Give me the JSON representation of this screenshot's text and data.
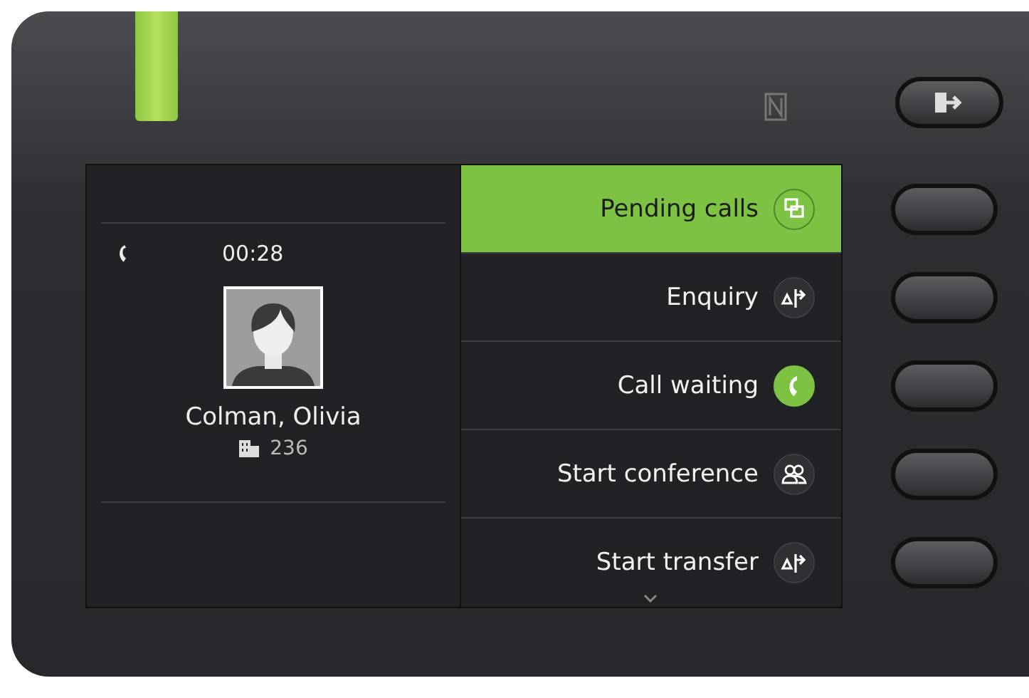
{
  "call": {
    "duration": "00:28",
    "name": "Colman, Olivia",
    "extension": "236"
  },
  "menu": [
    {
      "label": "Pending calls",
      "kind": "pending",
      "selected": true
    },
    {
      "label": "Enquiry",
      "kind": "enquiry",
      "selected": false
    },
    {
      "label": "Call waiting",
      "kind": "answer",
      "selected": false
    },
    {
      "label": "Start conference",
      "kind": "conference",
      "selected": false
    },
    {
      "label": "Start transfer",
      "kind": "transfer",
      "selected": false
    }
  ]
}
